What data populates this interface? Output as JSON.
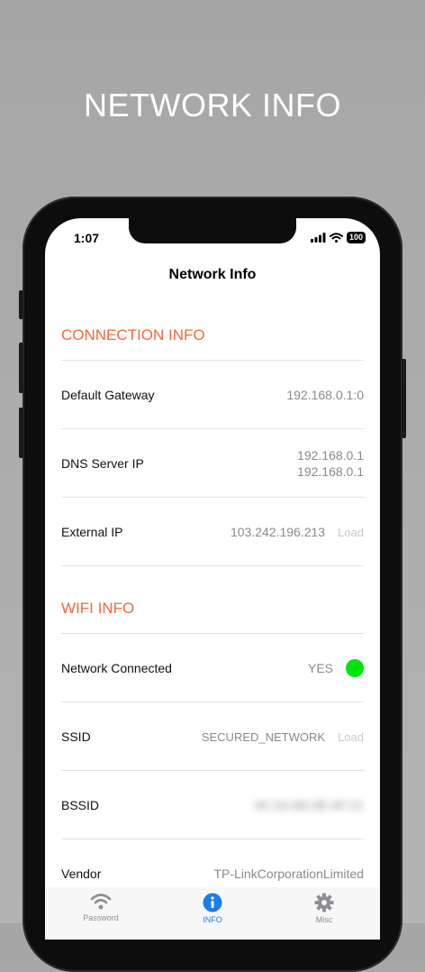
{
  "hero_title": "NETWORK INFO",
  "status_bar": {
    "time": "1:07",
    "battery": "100"
  },
  "nav": {
    "title": "Network Info"
  },
  "connection_info": {
    "header": "CONNECTION INFO",
    "default_gateway": {
      "label": "Default Gateway",
      "value": "192.168.0.1:0"
    },
    "dns_server_ip": {
      "label": "DNS Server IP",
      "values": [
        "192.168.0.1",
        "192.168.0.1"
      ]
    },
    "external_ip": {
      "label": "External IP",
      "value": "103.242.196.213",
      "action": "Load"
    }
  },
  "wifi_info": {
    "header": "WIFI INFO",
    "network_connected": {
      "label": "Network Connected",
      "value": "YES",
      "indicator_color": "#00e40d"
    },
    "ssid": {
      "label": "SSID",
      "value": "SECURED_NETWORK",
      "action": "Load"
    },
    "bssid": {
      "label": "BSSID",
      "value": "6C:5A:B0:3E:4F:21"
    },
    "vendor": {
      "label": "Vendor",
      "value": "TP-LinkCorporationLimited"
    }
  },
  "tabs": [
    {
      "label": "Password",
      "icon": "wifi-icon",
      "active": false
    },
    {
      "label": "INFO",
      "icon": "info-icon",
      "active": true
    },
    {
      "label": "Misc",
      "icon": "gear-icon",
      "active": false
    }
  ],
  "colors": {
    "accent": "#f06a3a",
    "tab_active": "#1a7ee6",
    "tab_inactive": "#8e8e93"
  }
}
